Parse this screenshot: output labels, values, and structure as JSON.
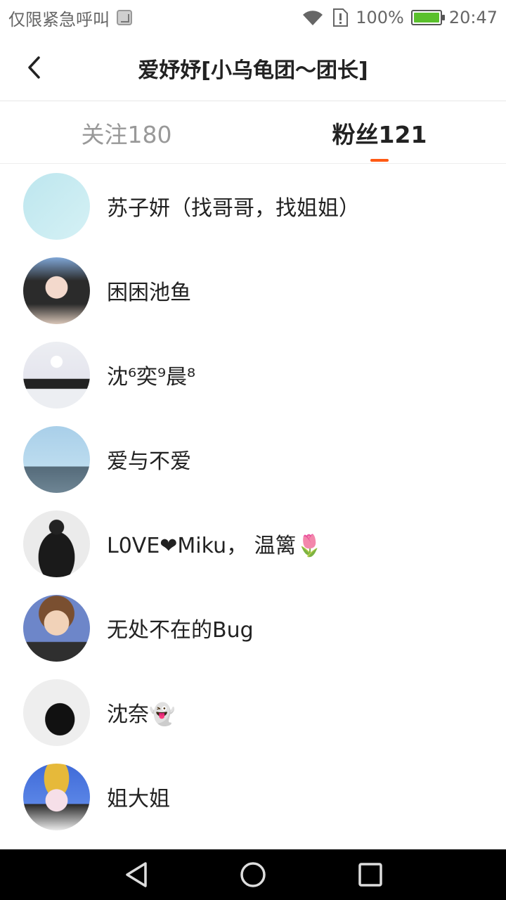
{
  "status_bar": {
    "carrier_text": "仅限紧急呼叫",
    "battery_text": "100%",
    "time": "20:47",
    "icons": [
      "sim-icon",
      "wifi-icon",
      "sim-card-alert-icon",
      "battery-charging-icon"
    ]
  },
  "header": {
    "title": "爱妤妤[小乌龟团～团长]",
    "back_icon": "chevron-left-icon"
  },
  "tabs": [
    {
      "label": "关注180",
      "active": false
    },
    {
      "label": "粉丝121",
      "active": true
    }
  ],
  "accent_color": "#ff5a14",
  "fans": [
    {
      "name": "苏子妍（找哥哥，找姐姐）"
    },
    {
      "name": "困困池鱼"
    },
    {
      "name": "沈⁶奕⁹晨⁸"
    },
    {
      "name": "爱与不爱"
    },
    {
      "name": "L0VE❤Miku， 温篱🌷"
    },
    {
      "name": "无处不在的Bug"
    },
    {
      "name": "沈奈👻"
    },
    {
      "name": "姐大姐"
    }
  ],
  "nav_bar": {
    "icons": [
      "back-triangle-icon",
      "home-circle-icon",
      "recents-square-icon"
    ]
  }
}
